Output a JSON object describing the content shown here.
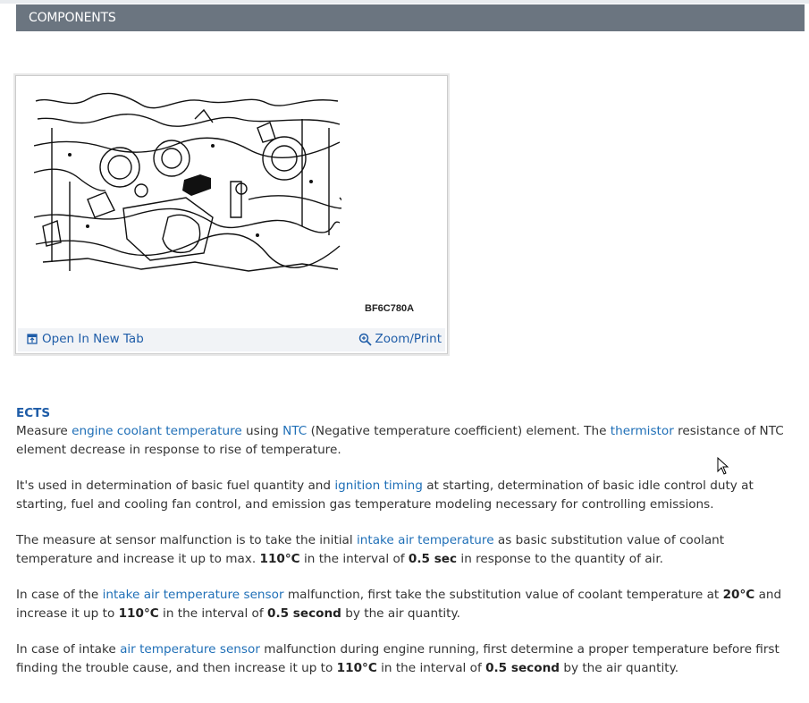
{
  "header": {
    "title": "COMPONENTS"
  },
  "figure": {
    "code": "BF6C780A",
    "open_label": "Open In New Tab",
    "zoom_label": "Zoom/Print",
    "image_icon": "engine-diagram-image"
  },
  "article": {
    "heading": "ECTS",
    "p1": {
      "t1": "Measure ",
      "l1": "engine coolant temperature",
      "t2": " using ",
      "l2": "NTC",
      "t3": " (Negative temperature coefficient) element. The ",
      "l3": "thermistor",
      "t4": " resistance of NTC element decrease in response to rise of temperature."
    },
    "p2": {
      "t1": "It's used in determination of basic fuel quantity and ",
      "l1": "ignition timing",
      "t2": " at starting, determination of basic idle control duty at starting, fuel and cooling fan control, and emission gas temperature modeling necessary for controlling emissions."
    },
    "p3": {
      "t1": "The measure at sensor malfunction is to take the initial ",
      "l1": "intake air temperature",
      "t2": " as basic substitution value of coolant temperature and increase it up to max. ",
      "b1": "110°C",
      "t3": " in the interval of ",
      "b2": "0.5 sec",
      "t4": " in response to the quantity of air."
    },
    "p4": {
      "t1": "In case of the ",
      "l1": "intake air temperature sensor",
      "t2": " malfunction, first take the substitution value of coolant temperature at ",
      "b1": "20°C",
      "t3": " and increase it up to ",
      "b2": "110°C",
      "t4": " in the interval of ",
      "b3": "0.5 second",
      "t5": " by the air quantity."
    },
    "p5": {
      "t1": "In case of intake ",
      "l1": "air temperature sensor",
      "t2": " malfunction during engine running, first determine a proper temperature before first finding the trouble cause, and then increase it up to ",
      "b1": "110°C",
      "t3": " in the interval of ",
      "b2": "0.5 second",
      "t4": " by the air quantity."
    }
  }
}
